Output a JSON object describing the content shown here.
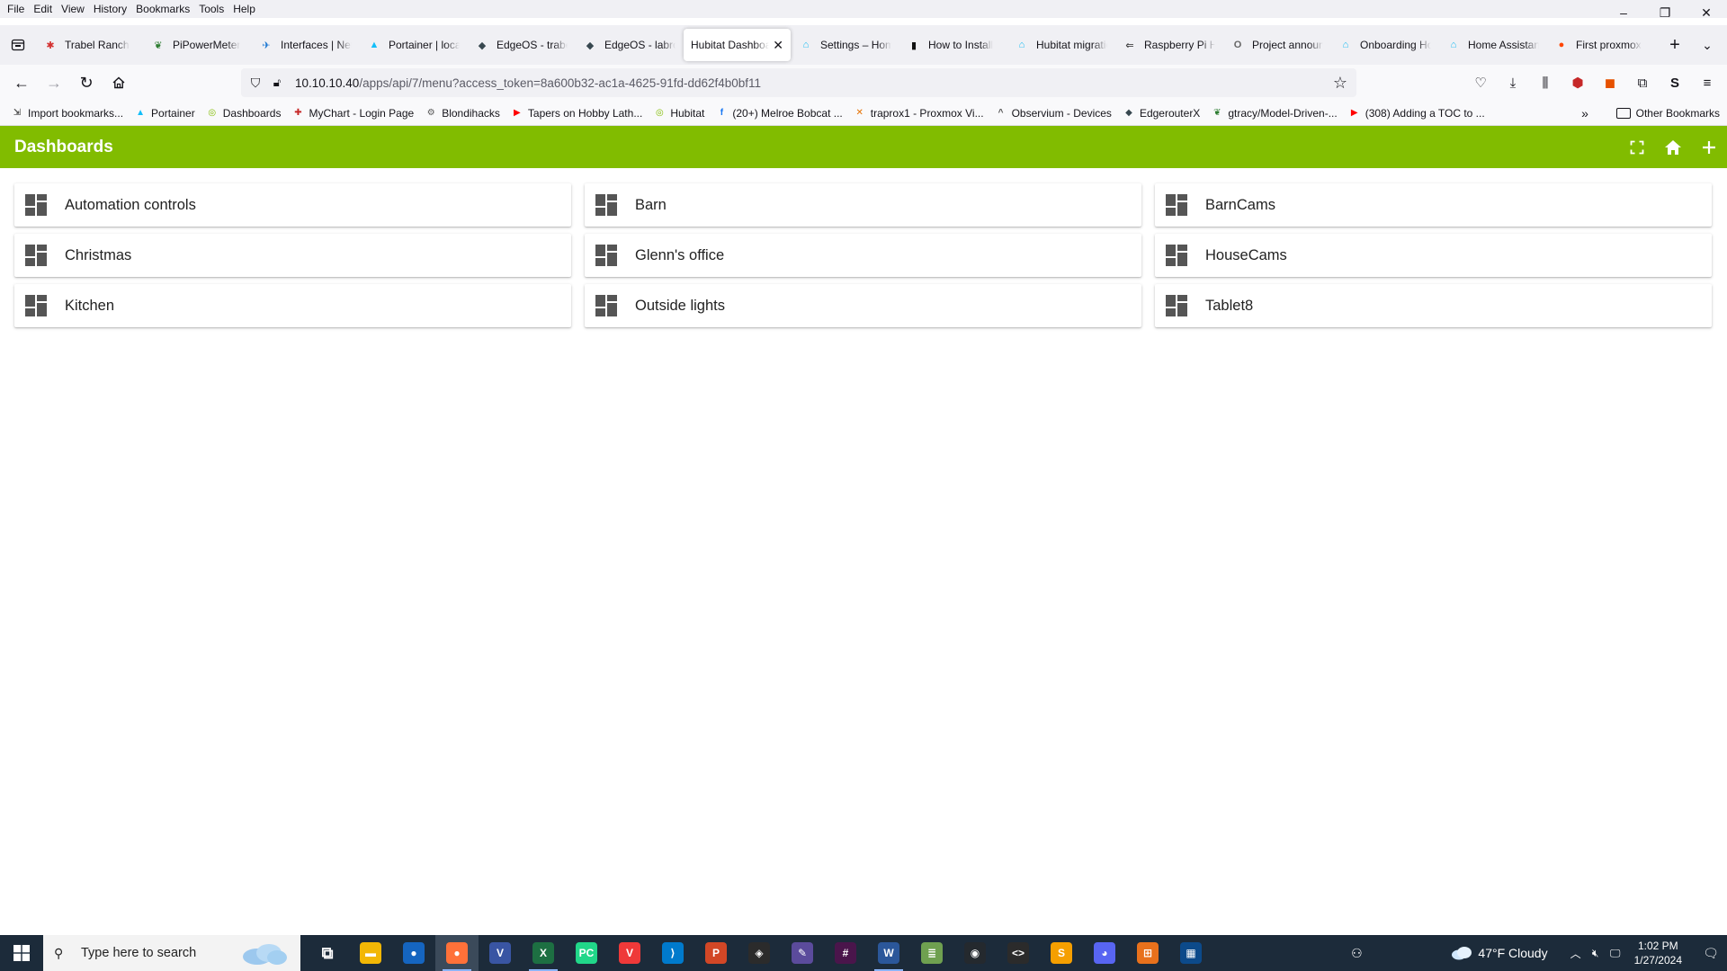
{
  "menubar": [
    "File",
    "Edit",
    "View",
    "History",
    "Bookmarks",
    "Tools",
    "Help"
  ],
  "window_controls": {
    "minimize": "–",
    "restore": "❐",
    "close": "✕"
  },
  "tabs": [
    {
      "title": "Trabel Ranch",
      "icon": "puzzle-icon",
      "color": "#d32f2f",
      "glyph": "✱"
    },
    {
      "title": "PiPowerMeter",
      "icon": "leaf-icon",
      "color": "#2e7d32",
      "glyph": "❦"
    },
    {
      "title": "Interfaces | Network",
      "icon": "plane-icon",
      "color": "#1976d2",
      "glyph": "✈"
    },
    {
      "title": "Portainer | local",
      "icon": "portainer-icon",
      "color": "#13bef9",
      "glyph": "▲"
    },
    {
      "title": "EdgeOS - trabel",
      "icon": "edgeos-icon",
      "color": "#37474f",
      "glyph": "◆"
    },
    {
      "title": "EdgeOS - labrouter",
      "icon": "edgeos-icon",
      "color": "#37474f",
      "glyph": "◆"
    },
    {
      "title": "Hubitat Dashboard",
      "icon": "none",
      "color": "#ffffff",
      "glyph": "",
      "active": true
    },
    {
      "title": "Settings – Home Assistant",
      "icon": "home-assistant-icon",
      "color": "#18bcf2",
      "glyph": "⌂"
    },
    {
      "title": "How to Install",
      "icon": "terminal-icon",
      "color": "#111111",
      "glyph": "▮"
    },
    {
      "title": "Hubitat migration",
      "icon": "home-assistant-icon",
      "color": "#18bcf2",
      "glyph": "⌂"
    },
    {
      "title": "Raspberry Pi Home",
      "icon": "arrow-icon",
      "color": "#444444",
      "glyph": "⇐"
    },
    {
      "title": "Project announcement",
      "icon": "om-icon",
      "color": "#666666",
      "glyph": "O"
    },
    {
      "title": "Onboarding Home",
      "icon": "home-assistant-icon",
      "color": "#18bcf2",
      "glyph": "⌂"
    },
    {
      "title": "Home Assistant",
      "icon": "home-assistant-icon",
      "color": "#18bcf2",
      "glyph": "⌂"
    },
    {
      "title": "First proxmox",
      "icon": "reddit-icon",
      "color": "#ff4500",
      "glyph": "●"
    }
  ],
  "address": {
    "host": "10.10.10.40",
    "path": "/apps/api/7/menu?access_token=8a600b32-ac1a-4625-91fd-dd62f4b0bf11"
  },
  "bookmarks": [
    {
      "label": "Import bookmarks...",
      "icon": "import-icon",
      "color": "#444444",
      "glyph": "⇲"
    },
    {
      "label": "Portainer",
      "icon": "portainer-icon",
      "color": "#13bef9",
      "glyph": "▲"
    },
    {
      "label": "Dashboards",
      "icon": "hubitat-icon",
      "color": "#81bc00",
      "glyph": "◎"
    },
    {
      "label": "MyChart - Login Page",
      "icon": "mychart-icon",
      "color": "#c62828",
      "glyph": "✚"
    },
    {
      "label": "Blondihacks",
      "icon": "gear-icon",
      "color": "#555555",
      "glyph": "⚙"
    },
    {
      "label": "Tapers on Hobby Lath...",
      "icon": "youtube-icon",
      "color": "#ff0000",
      "glyph": "▶"
    },
    {
      "label": "Hubitat",
      "icon": "hubitat-icon",
      "color": "#81bc00",
      "glyph": "◎"
    },
    {
      "label": "(20+) Melroe Bobcat ...",
      "icon": "facebook-icon",
      "color": "#1877f2",
      "glyph": "f"
    },
    {
      "label": "traprox1 - Proxmox Vi...",
      "icon": "proxmox-icon",
      "color": "#e57000",
      "glyph": "✕"
    },
    {
      "label": "Observium - Devices",
      "icon": "observium-icon",
      "color": "#555555",
      "glyph": "^"
    },
    {
      "label": "EdgerouterX",
      "icon": "edgeos-icon",
      "color": "#37474f",
      "glyph": "◆"
    },
    {
      "label": "gtracy/Model-Driven-...",
      "icon": "leaf-icon",
      "color": "#2e7d32",
      "glyph": "❦"
    },
    {
      "label": "(308) Adding a TOC to ...",
      "icon": "youtube-icon",
      "color": "#ff0000",
      "glyph": "▶"
    }
  ],
  "other_bookmarks": "Other Bookmarks",
  "app": {
    "title": "Dashboards",
    "accent": "#81bc00"
  },
  "dashboards": [
    "Automation controls",
    "Barn",
    "BarnCams",
    "Christmas",
    "Glenn's office",
    "HouseCams",
    "Kitchen",
    "Outside lights",
    "Tablet8"
  ],
  "taskbar": {
    "search_placeholder": "Type here to search",
    "apps": [
      {
        "name": "task-view",
        "color": "#1c2b3a",
        "glyph": "⧉"
      },
      {
        "name": "file-explorer",
        "color": "#f2b705",
        "glyph": "▬"
      },
      {
        "name": "browser-blue",
        "color": "#1565c0",
        "glyph": "●"
      },
      {
        "name": "firefox",
        "color": "#ff7139",
        "glyph": "●",
        "running": true,
        "focused": true
      },
      {
        "name": "visio",
        "color": "#3955a3",
        "glyph": "V"
      },
      {
        "name": "excel",
        "color": "#1d6f42",
        "glyph": "X",
        "running": true
      },
      {
        "name": "pycharm",
        "color": "#21d789",
        "glyph": "PC"
      },
      {
        "name": "vivaldi",
        "color": "#ef3939",
        "glyph": "V"
      },
      {
        "name": "vscode",
        "color": "#007acc",
        "glyph": "⟩"
      },
      {
        "name": "powerpoint",
        "color": "#d24726",
        "glyph": "P"
      },
      {
        "name": "3d-app",
        "color": "#2b2b2b",
        "glyph": "◈"
      },
      {
        "name": "pen-app",
        "color": "#5b4b9c",
        "glyph": "✎"
      },
      {
        "name": "slack",
        "color": "#4a154b",
        "glyph": "#"
      },
      {
        "name": "word",
        "color": "#2b579a",
        "glyph": "W",
        "running": true
      },
      {
        "name": "notepad",
        "color": "#6fa050",
        "glyph": "≣"
      },
      {
        "name": "github",
        "color": "#24292e",
        "glyph": "◉"
      },
      {
        "name": "code-app",
        "color": "#2b2b2b",
        "glyph": "<>"
      },
      {
        "name": "sublime",
        "color": "#f59f00",
        "glyph": "S"
      },
      {
        "name": "discord",
        "color": "#5865f2",
        "glyph": "◕"
      },
      {
        "name": "network-app",
        "color": "#e8711c",
        "glyph": "⊞"
      },
      {
        "name": "monitor-app",
        "color": "#0c4a8a",
        "glyph": "▦"
      }
    ],
    "weather": "47°F  Cloudy",
    "time": "1:02 PM",
    "date": "1/27/2024"
  }
}
